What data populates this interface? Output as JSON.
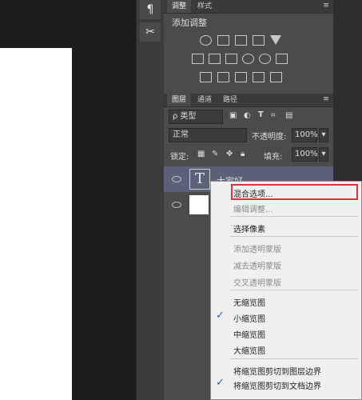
{
  "tools": {
    "paragraph_icon": "¶",
    "tools_icon": "✂"
  },
  "adjustments_panel": {
    "tabs": [
      "调整",
      "样式"
    ],
    "title": "添加调整"
  },
  "layers_panel": {
    "tabs": [
      "图层",
      "通道",
      "路径"
    ],
    "filter_label": "ρ 类型",
    "blend_mode": "正常",
    "opacity_label": "不透明度:",
    "opacity_value": "100%",
    "lock_label": "锁定:",
    "fill_label": "填充:",
    "fill_value": "100%",
    "text_layer_glyph": "T",
    "text_layer_name": "大家好"
  },
  "context_menu": {
    "items": [
      "混合选项...",
      "编辑调整...",
      "选择像素",
      "添加透明蒙版",
      "减去透明蒙版",
      "交叉透明蒙版",
      "无缩览图",
      "小缩览图",
      "中缩览图",
      "大缩览图",
      "将缩览图剪切到图层边界",
      "将缩览图剪切到文档边界"
    ],
    "checkmark": "✓"
  },
  "colors": {
    "highlight": "#e0343c",
    "panel_bg": "#4b4b4b"
  }
}
